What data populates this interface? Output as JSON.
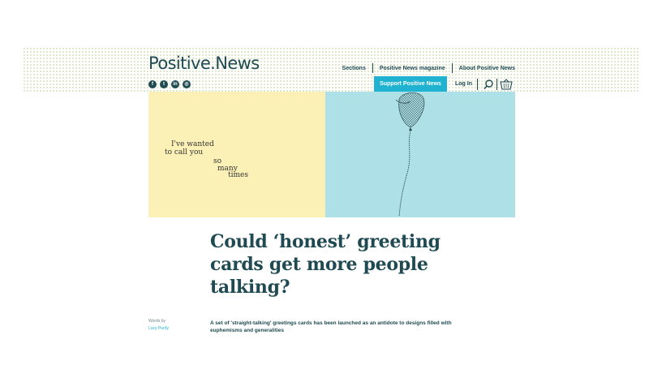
{
  "site": {
    "logo": "Positive.News",
    "social": [
      {
        "icon": "facebook-icon",
        "glyph": "f"
      },
      {
        "icon": "twitter-icon",
        "glyph": "t"
      },
      {
        "icon": "linkedin-icon",
        "glyph": "in"
      },
      {
        "icon": "instagram-icon",
        "glyph": "◎"
      }
    ]
  },
  "nav": {
    "items": [
      "Sections",
      "Positive News magazine",
      "About Positive News"
    ],
    "support_label": "Support Positive News",
    "login_label": "Log In"
  },
  "hero": {
    "left_bg": "#fbf1b6",
    "right_bg": "#ade0e7",
    "poem_lines": [
      "I've wanted",
      "to call you",
      "so",
      "many",
      "times"
    ]
  },
  "article": {
    "headline_lines": [
      "Could ‘honest’ greeting",
      "cards get more people",
      "talking?"
    ],
    "byline_label": "Words by",
    "byline_name": "Lucy Purdy",
    "standfirst": "A set of 'straight-talking' greetings cards has been launched as an antidote to designs filled with euphemisms and generalities"
  },
  "colors": {
    "accent": "#1fb3d1",
    "text": "#1f4a52"
  }
}
